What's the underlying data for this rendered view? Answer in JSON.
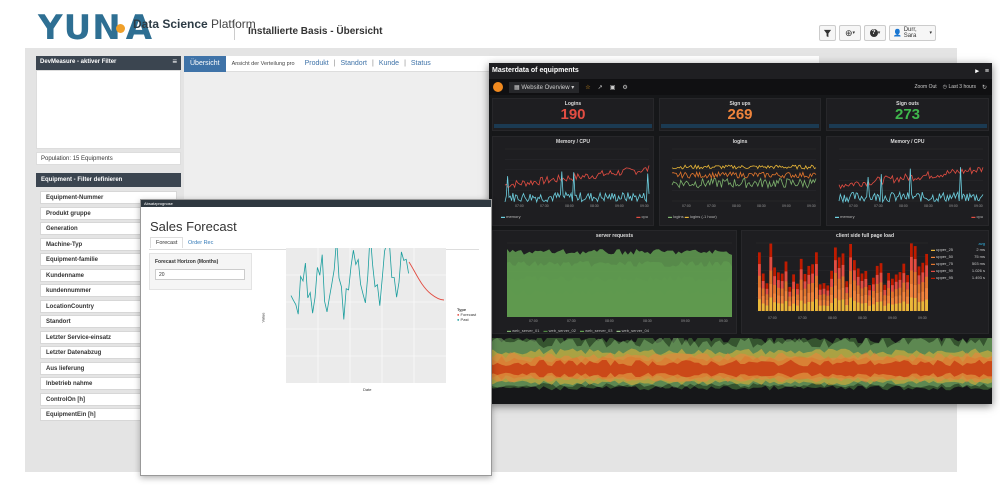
{
  "header": {
    "logo_text": "YUN",
    "brand_bold": "Data Science",
    "brand_light": " Platform",
    "breadcrumb": "Installierte Basis - Übersicht",
    "filter_icon": "filter-icon",
    "globe_icon": "globe-icon",
    "help_icon": "help-icon",
    "user_label": "Durr, Sara"
  },
  "left": {
    "dev_title": "DevMeasure - aktiver Filter",
    "population": "Population: 15 Equipments",
    "filter_title": "Equipment - Filter definieren",
    "filters": [
      "Equipment-Nummer",
      "Produkt gruppe",
      "Generation",
      "Machine-Typ",
      "Equipment-familie",
      "Kundenname",
      "kundennummer",
      "LocationCountry",
      "Standort",
      "Letzter Service-einsatz",
      "Letzter Datenabzug",
      "Aus lieferung",
      "Inbetrieb nahme",
      "ControlOn [h]",
      "EquipmentEin [h]"
    ]
  },
  "tabs": {
    "active": "Übersicht",
    "desc": "Ansicht der Verteilung pro",
    "links": [
      "Produkt",
      "Standort",
      "Kunde",
      "Status"
    ]
  },
  "grafana": {
    "title": "Masterdata of equipments",
    "dashboard": "Website Overview",
    "zoom": "Zoom Out",
    "range": "Last 3 hours",
    "stats": [
      {
        "title": "Logins",
        "value": "190",
        "color": "#e24d42"
      },
      {
        "title": "Sign ups",
        "value": "269",
        "color": "#ef843c"
      },
      {
        "title": "Sign outs",
        "value": "273",
        "color": "#3fb84c"
      }
    ],
    "graphs": [
      "Memory / CPU",
      "logins",
      "Memory / CPU"
    ],
    "graph_legends": [
      [
        "memory",
        "cpu"
      ],
      [
        "logins",
        "logins (-1 hour)"
      ],
      [
        "memory",
        "cpu"
      ]
    ],
    "times": [
      "07:00",
      "07:30",
      "08:00",
      "08:30",
      "09:00",
      "09:30"
    ],
    "server_title": "server requests",
    "server_legend": [
      "web_server_01",
      "web_server_02",
      "web_server_03",
      "web_server_04"
    ],
    "client_title": "client side full page load",
    "client_legend": [
      {
        "name": "upper_25",
        "val": "2 ms"
      },
      {
        "name": "upper_50",
        "val": "75 ms"
      },
      {
        "name": "upper_75",
        "val": "503 ms"
      },
      {
        "name": "upper_90",
        "val": "1.026 s"
      },
      {
        "name": "upper_95",
        "val": "1.493 s"
      }
    ],
    "client_avg": "avg"
  },
  "forecast": {
    "window_title": "Absatzprognose",
    "title": "Sales Forecast",
    "tab1": "Forecast",
    "tab2": "Order Rec",
    "horizon_label": "Forecast Horizon (Months)",
    "horizon_value": "20",
    "legend_title": "Type",
    "legend_items": [
      "Forecast",
      "Past"
    ],
    "xlabel": "Date",
    "ylabel": "Value"
  }
}
